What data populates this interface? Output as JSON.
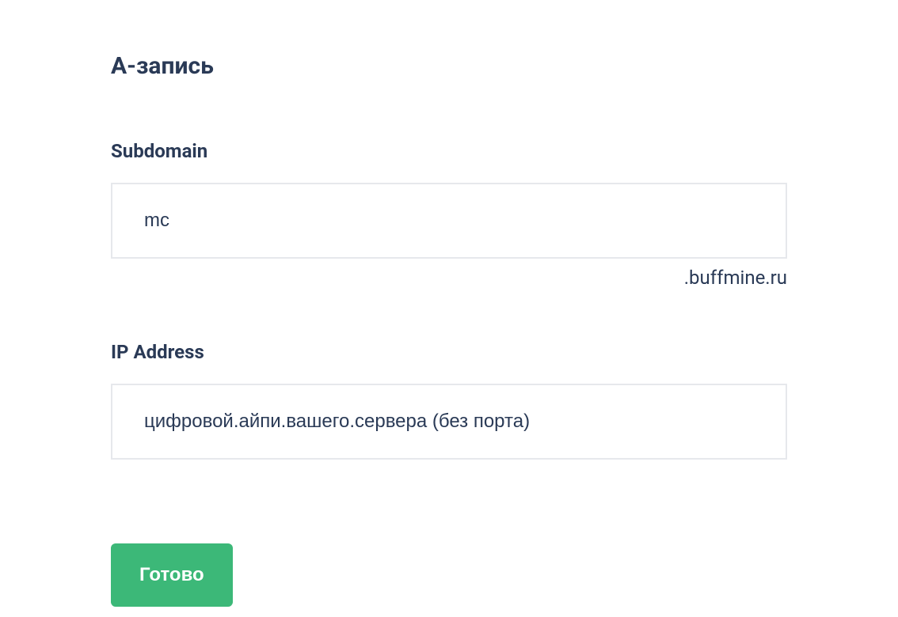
{
  "form": {
    "title": "А-запись",
    "subdomain": {
      "label": "Subdomain",
      "value": "mc",
      "suffix": ".buffmine.ru"
    },
    "ip": {
      "label": "IP Address",
      "placeholder": "цифровой.айпи.вашего.сервера (без порта)",
      "value": ""
    },
    "submit_label": "Готово"
  }
}
